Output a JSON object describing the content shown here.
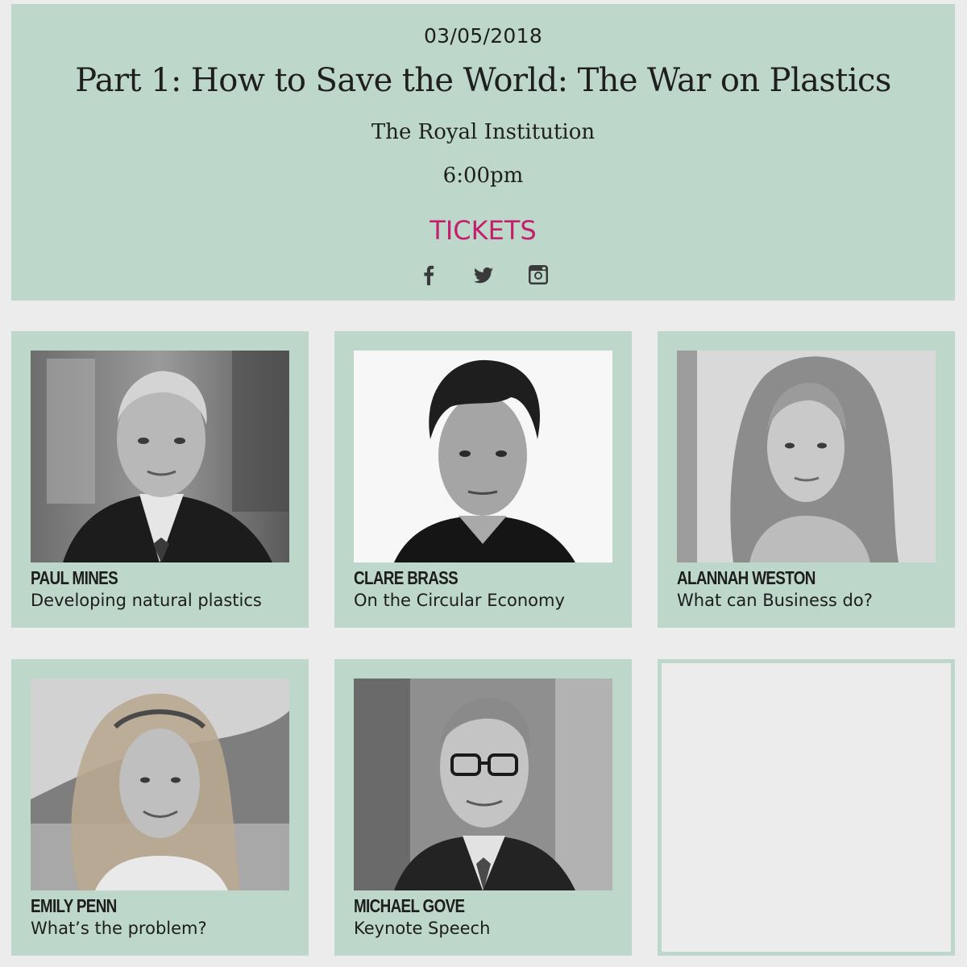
{
  "event": {
    "date": "03/05/2018",
    "title": "Part 1: How to Save the World: The War on Plastics",
    "venue": "The Royal Institution",
    "time": "6:00pm",
    "tickets_label": "TICKETS",
    "social_icons": [
      "facebook-icon",
      "twitter-icon",
      "instagram-icon"
    ]
  },
  "speakers": [
    {
      "name": "PAUL MINES",
      "topic": "Developing natural plastics"
    },
    {
      "name": "CLARE BRASS",
      "topic": "On the Circular Economy"
    },
    {
      "name": "ALANNAH WESTON",
      "topic": "What can Business do?"
    },
    {
      "name": "EMILY PENN",
      "topic": "What’s the problem?"
    },
    {
      "name": "MICHAEL GOVE",
      "topic": "Keynote Speech"
    }
  ],
  "colors": {
    "panel": "#bdd7cb",
    "page_background": "#ececec",
    "accent": "#c41f6b",
    "text": "#1f1f1f"
  }
}
